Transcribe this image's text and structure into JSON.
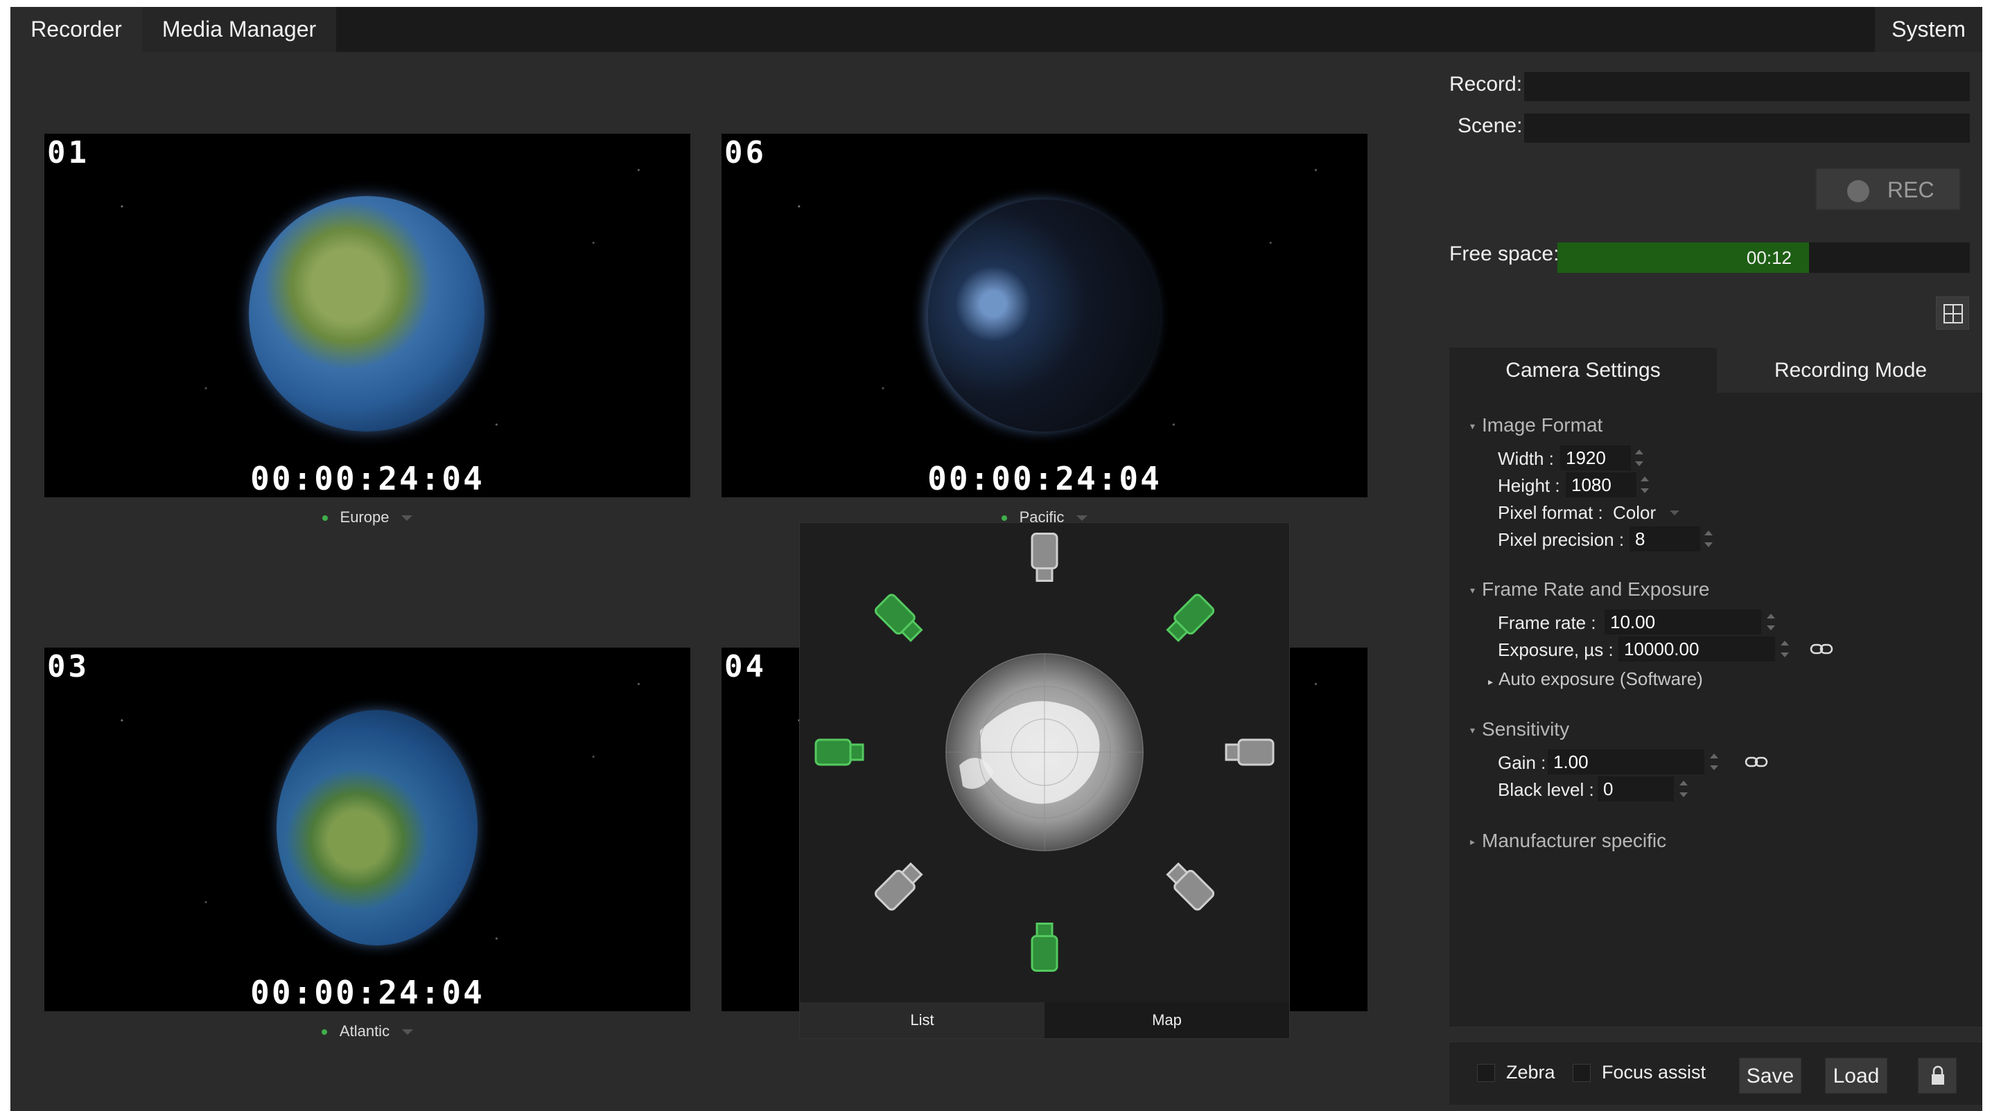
{
  "top_tabs": {
    "recorder": "Recorder",
    "media_manager": "Media Manager",
    "system": "System"
  },
  "cameras": [
    {
      "number": "01",
      "timecode": "00:00:24:04",
      "label": "Europe"
    },
    {
      "number": "06",
      "timecode": "00:00:24:04",
      "label": "Pacific"
    },
    {
      "number": "03",
      "timecode": "00:00:24:04",
      "label": "Atlantic"
    },
    {
      "number": "04"
    }
  ],
  "map_popup": {
    "tabs": {
      "list": "List",
      "map": "Map"
    },
    "active_tab": "Map",
    "camera_states": [
      "gray",
      "green",
      "gray",
      "gray",
      "green",
      "gray",
      "green",
      "green"
    ]
  },
  "recording": {
    "record_label": "Record:",
    "record_value": "",
    "scene_label": "Scene:",
    "scene_value": "",
    "rec_button": "REC",
    "free_space_label": "Free space:",
    "free_space_value": "00:12",
    "free_space_fraction": 0.61
  },
  "settings": {
    "tabs": {
      "camera": "Camera Settings",
      "recording_mode": "Recording Mode"
    },
    "image_format": {
      "title": "Image Format",
      "width_label": "Width :",
      "width": "1920",
      "height_label": "Height :",
      "height": "1080",
      "pixel_format_label": "Pixel format :",
      "pixel_format": "Color",
      "pixel_precision_label": "Pixel precision :",
      "pixel_precision": "8"
    },
    "frame_rate": {
      "title": "Frame Rate and Exposure",
      "frame_rate_label": "Frame rate :",
      "frame_rate": "10.00",
      "exposure_label": "Exposure, µs :",
      "exposure": "10000.00",
      "auto_exposure": "Auto exposure (Software)"
    },
    "sensitivity": {
      "title": "Sensitivity",
      "gain_label": "Gain :",
      "gain": "1.00",
      "black_level_label": "Black level :",
      "black_level": "0"
    },
    "manufacturer": "Manufacturer specific"
  },
  "bottom_bar": {
    "zebra": "Zebra",
    "focus_assist": "Focus assist",
    "save": "Save",
    "load": "Load"
  },
  "colors": {
    "accent_green": "#3fae4a",
    "progress_green": "#1d5e14",
    "background": "#2b2b2b"
  }
}
